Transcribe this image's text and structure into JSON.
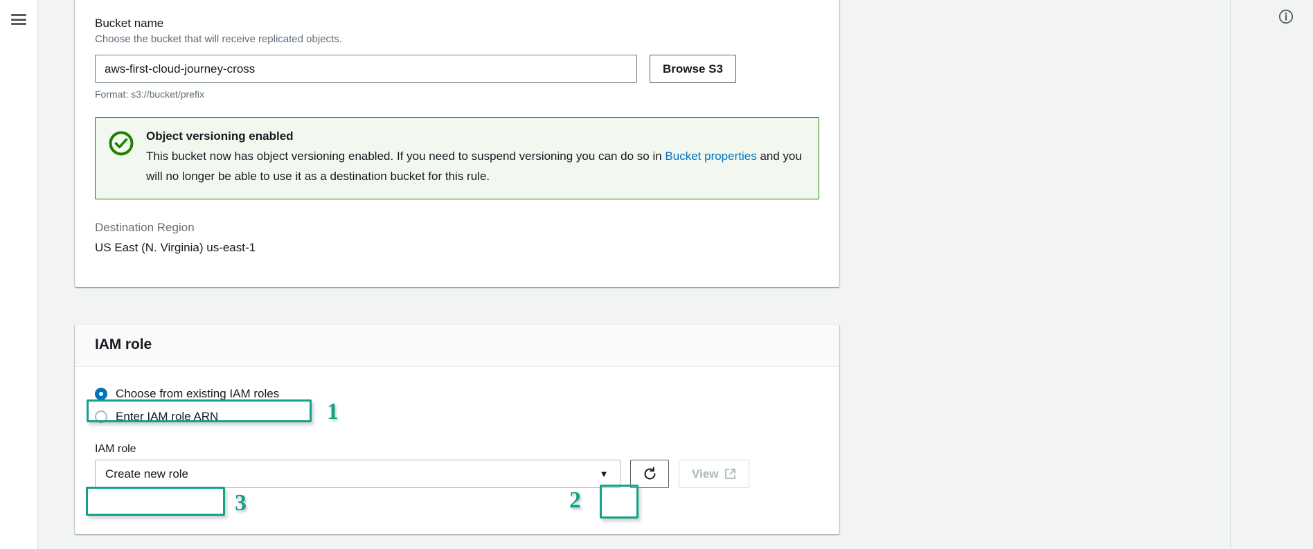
{
  "chrome": {
    "menu_icon": "hamburger-menu-icon",
    "info_icon": "info-circle-icon"
  },
  "destination_card": {
    "bucket_name": {
      "label": "Bucket name",
      "description": "Choose the bucket that will receive replicated objects.",
      "value": "aws-first-cloud-journey-cross",
      "placeholder": "s3://bucket/prefix",
      "hint": "Format: s3://bucket/prefix",
      "browse_button": "Browse S3"
    },
    "alert": {
      "status": "success",
      "icon": "check-circle-icon",
      "title": "Object versioning enabled",
      "body_part1": "This bucket now has object versioning enabled. If you need to suspend versioning you can do so in ",
      "link_text": "Bucket properties",
      "body_part2": " and you will no longer be able to use it as a destination bucket for this rule.",
      "border_color": "#1d8102",
      "background_color": "#f2f8f0"
    },
    "destination_region": {
      "label": "Destination Region",
      "value": "US East (N. Virginia) us-east-1"
    }
  },
  "iam_card": {
    "title": "IAM role",
    "radio_options": [
      {
        "label": "Choose from existing IAM roles",
        "selected": true
      },
      {
        "label": "Enter IAM role ARN",
        "selected": false
      }
    ],
    "select": {
      "label": "IAM role",
      "value": "Create new role",
      "caret_icon": "chevron-down-icon"
    },
    "refresh_button": {
      "icon": "refresh-icon",
      "label": ""
    },
    "view_button": {
      "label": "View",
      "icon": "external-link-icon",
      "disabled": true
    }
  },
  "annotations": {
    "accent_color": "#11a288",
    "markers": [
      {
        "number": "1",
        "target": "choose-from-existing-iam-roles-radio"
      },
      {
        "number": "2",
        "target": "iam-role-select-caret"
      },
      {
        "number": "3",
        "target": "iam-role-select-value"
      }
    ]
  }
}
